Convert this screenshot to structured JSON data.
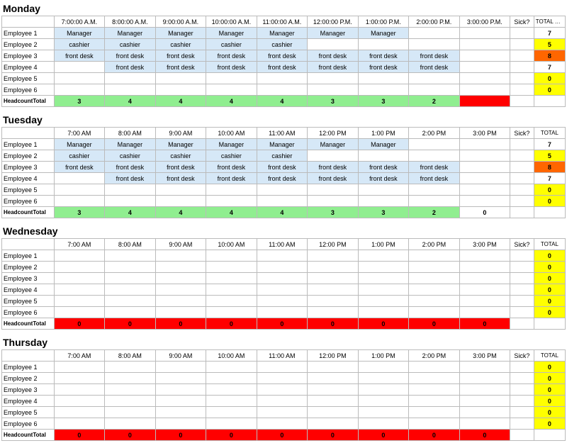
{
  "days": [
    {
      "name": "Monday",
      "times": [
        "7:00:00 A.M.",
        "8:00:00 A.M.",
        "9:00:00 A.M.",
        "10:00:00 A.M.",
        "11:00:00 A.M.",
        "12:00:00 P.M.",
        "1:00:00 P.M.",
        "2:00:00 P.M.",
        "3:00:00 P.M."
      ],
      "total_header": "TOTAL hours worked",
      "employees": [
        {
          "name": "Employee 1",
          "shifts": [
            "Manager",
            "Manager",
            "Manager",
            "Manager",
            "Manager",
            "Manager",
            "Manager",
            "",
            ""
          ],
          "sick": "",
          "total": "7",
          "total_color": "white"
        },
        {
          "name": "Employee 2",
          "shifts": [
            "cashier",
            "cashier",
            "cashier",
            "cashier",
            "cashier",
            "",
            "",
            "",
            ""
          ],
          "sick": "",
          "total": "5",
          "total_color": "yellow"
        },
        {
          "name": "Employee 3",
          "shifts": [
            "front desk",
            "front desk",
            "front desk",
            "front desk",
            "front desk",
            "front desk",
            "front desk",
            "front desk",
            ""
          ],
          "sick": "",
          "total": "8",
          "total_color": "orange"
        },
        {
          "name": "Employee 4",
          "shifts": [
            "",
            "front desk",
            "front desk",
            "front desk",
            "front desk",
            "front desk",
            "front desk",
            "front desk",
            ""
          ],
          "sick": "",
          "total": "7",
          "total_color": "white"
        },
        {
          "name": "Employee 5",
          "shifts": [
            "",
            "",
            "",
            "",
            "",
            "",
            "",
            "",
            ""
          ],
          "sick": "",
          "total": "0",
          "total_color": "yellow"
        },
        {
          "name": "Employee 6",
          "shifts": [
            "",
            "",
            "",
            "",
            "",
            "",
            "",
            "",
            ""
          ],
          "sick": "",
          "total": "0",
          "total_color": "yellow"
        }
      ],
      "headcount": [
        "3",
        "4",
        "4",
        "4",
        "4",
        "3",
        "3",
        "2",
        ""
      ],
      "headcount_last_color": "red"
    },
    {
      "name": "Tuesday",
      "times": [
        "7:00 AM",
        "8:00 AM",
        "9:00 AM",
        "10:00 AM",
        "11:00 AM",
        "12:00 PM",
        "1:00 PM",
        "2:00 PM",
        "3:00 PM"
      ],
      "total_header": "TOTAL",
      "employees": [
        {
          "name": "Employee 1",
          "shifts": [
            "Manager",
            "Manager",
            "Manager",
            "Manager",
            "Manager",
            "Manager",
            "Manager",
            "",
            ""
          ],
          "sick": "",
          "total": "7",
          "total_color": "white"
        },
        {
          "name": "Employee 2",
          "shifts": [
            "cashier",
            "cashier",
            "cashier",
            "cashier",
            "cashier",
            "",
            "",
            "",
            ""
          ],
          "sick": "",
          "total": "5",
          "total_color": "yellow"
        },
        {
          "name": "Employee 3",
          "shifts": [
            "front desk",
            "front desk",
            "front desk",
            "front desk",
            "front desk",
            "front desk",
            "front desk",
            "front desk",
            ""
          ],
          "sick": "",
          "total": "8",
          "total_color": "orange"
        },
        {
          "name": "Employee 4",
          "shifts": [
            "",
            "front desk",
            "front desk",
            "front desk",
            "front desk",
            "front desk",
            "front desk",
            "front desk",
            ""
          ],
          "sick": "",
          "total": "7",
          "total_color": "white"
        },
        {
          "name": "Employee 5",
          "shifts": [
            "",
            "",
            "",
            "",
            "",
            "",
            "",
            "",
            ""
          ],
          "sick": "",
          "total": "0",
          "total_color": "yellow"
        },
        {
          "name": "Employee 6",
          "shifts": [
            "",
            "",
            "",
            "",
            "",
            "",
            "",
            "",
            ""
          ],
          "sick": "",
          "total": "0",
          "total_color": "yellow"
        }
      ],
      "headcount": [
        "3",
        "4",
        "4",
        "4",
        "4",
        "3",
        "3",
        "2",
        "0"
      ],
      "headcount_last_color": "white"
    },
    {
      "name": "Wednesday",
      "times": [
        "7:00 AM",
        "8:00 AM",
        "9:00 AM",
        "10:00 AM",
        "11:00 AM",
        "12:00 PM",
        "1:00 PM",
        "2:00 PM",
        "3:00 PM"
      ],
      "total_header": "TOTAL",
      "employees": [
        {
          "name": "Employee 1",
          "shifts": [
            "",
            "",
            "",
            "",
            "",
            "",
            "",
            "",
            ""
          ],
          "sick": "",
          "total": "0",
          "total_color": "yellow"
        },
        {
          "name": "Employee 2",
          "shifts": [
            "",
            "",
            "",
            "",
            "",
            "",
            "",
            "",
            ""
          ],
          "sick": "",
          "total": "0",
          "total_color": "yellow"
        },
        {
          "name": "Employee 3",
          "shifts": [
            "",
            "",
            "",
            "",
            "",
            "",
            "",
            "",
            ""
          ],
          "sick": "",
          "total": "0",
          "total_color": "yellow"
        },
        {
          "name": "Employee 4",
          "shifts": [
            "",
            "",
            "",
            "",
            "",
            "",
            "",
            "",
            ""
          ],
          "sick": "",
          "total": "0",
          "total_color": "yellow"
        },
        {
          "name": "Employee 5",
          "shifts": [
            "",
            "",
            "",
            "",
            "",
            "",
            "",
            "",
            ""
          ],
          "sick": "",
          "total": "0",
          "total_color": "yellow"
        },
        {
          "name": "Employee 6",
          "shifts": [
            "",
            "",
            "",
            "",
            "",
            "",
            "",
            "",
            ""
          ],
          "sick": "",
          "total": "0",
          "total_color": "yellow"
        }
      ],
      "headcount": [
        "0",
        "0",
        "0",
        "0",
        "0",
        "0",
        "0",
        "0",
        "0"
      ],
      "headcount_last_color": "red"
    },
    {
      "name": "Thursday",
      "times": [
        "7:00 AM",
        "8:00 AM",
        "9:00 AM",
        "10:00 AM",
        "11:00 AM",
        "12:00 PM",
        "1:00 PM",
        "2:00 PM",
        "3:00 PM"
      ],
      "total_header": "TOTAL",
      "employees": [
        {
          "name": "Employee 1",
          "shifts": [
            "",
            "",
            "",
            "",
            "",
            "",
            "",
            "",
            ""
          ],
          "sick": "",
          "total": "0",
          "total_color": "yellow"
        },
        {
          "name": "Employee 2",
          "shifts": [
            "",
            "",
            "",
            "",
            "",
            "",
            "",
            "",
            ""
          ],
          "sick": "",
          "total": "0",
          "total_color": "yellow"
        },
        {
          "name": "Employee 3",
          "shifts": [
            "",
            "",
            "",
            "",
            "",
            "",
            "",
            "",
            ""
          ],
          "sick": "",
          "total": "0",
          "total_color": "yellow"
        },
        {
          "name": "Employee 4",
          "shifts": [
            "",
            "",
            "",
            "",
            "",
            "",
            "",
            "",
            ""
          ],
          "sick": "",
          "total": "0",
          "total_color": "yellow"
        },
        {
          "name": "Employee 5",
          "shifts": [
            "",
            "",
            "",
            "",
            "",
            "",
            "",
            "",
            ""
          ],
          "sick": "",
          "total": "0",
          "total_color": "yellow"
        },
        {
          "name": "Employee 6",
          "shifts": [
            "",
            "",
            "",
            "",
            "",
            "",
            "",
            "",
            ""
          ],
          "sick": "",
          "total": "0",
          "total_color": "yellow"
        }
      ],
      "headcount": [
        "0",
        "0",
        "0",
        "0",
        "0",
        "0",
        "0",
        "0",
        "0"
      ],
      "headcount_last_color": "red"
    }
  ],
  "shift_colors": {
    "Manager": "light-blue",
    "cashier": "light-blue",
    "front desk": "light-blue"
  }
}
